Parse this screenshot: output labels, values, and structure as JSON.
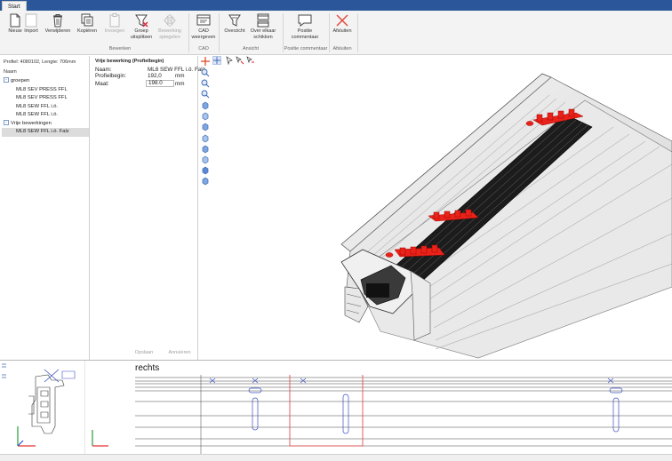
{
  "tabs": [
    {
      "label": "Start",
      "active": true
    }
  ],
  "ribbon": {
    "buttons": [
      {
        "id": "nieuw",
        "label": "Nieuw",
        "icon": "new-document-icon",
        "enabled": true
      },
      {
        "id": "import",
        "label": "Import",
        "icon": "import-icon",
        "enabled": true
      },
      {
        "id": "verwijderen",
        "label": "Verwijderen",
        "icon": "trash-icon",
        "enabled": true
      },
      {
        "id": "kopieren",
        "label": "Kopiëren",
        "icon": "copy-icon",
        "enabled": true
      },
      {
        "id": "invoegen",
        "label": "Invoegen",
        "icon": "paste-icon",
        "enabled": false
      },
      {
        "id": "groep_uitsplitsen",
        "label": "Groep uitsplitsen",
        "icon": "split-group-icon",
        "enabled": true
      },
      {
        "id": "bewerking_spiegelen",
        "label": "Bewerking spiegelen",
        "icon": "mirror-icon",
        "enabled": false
      },
      {
        "id": "cad_weergeven",
        "label": "CAD weergeven",
        "icon": "cad-icon",
        "enabled": true
      },
      {
        "id": "overzicht",
        "label": "Overzicht",
        "icon": "overview-icon",
        "enabled": true
      },
      {
        "id": "over_elkaar_schikken",
        "label": "Over elkaar schikken",
        "icon": "stack-windows-icon",
        "enabled": true
      },
      {
        "id": "positie_commentaar",
        "label": "Positie commentaar",
        "icon": "comment-icon",
        "enabled": true
      },
      {
        "id": "afsluiten",
        "label": "Afsluiten",
        "icon": "close-x-icon",
        "enabled": true
      }
    ],
    "groups": {
      "bewerken": "Bewerken",
      "cad": "CAD",
      "ansicht": "Ansicht",
      "positie_commentaar": "Positie commentaar",
      "afsluiten": "Afsluiten"
    }
  },
  "tree_panel": {
    "profile_info": "Profiel: 4080102, Lengte: 706mm",
    "column_header": "Naam",
    "nodes": [
      {
        "label": "groepen",
        "level": 0,
        "expander": "-",
        "selected": false
      },
      {
        "label": "ML8 SEV PRESS FFL",
        "level": 1,
        "selected": false
      },
      {
        "label": "ML8 SEV PRESS FFL",
        "level": 1,
        "selected": false
      },
      {
        "label": "ML8 SEW FFL i.ö.",
        "level": 1,
        "selected": false
      },
      {
        "label": "ML8 SEW FFL i.ö.",
        "level": 1,
        "selected": false
      },
      {
        "label": "Vrije bewerkingen",
        "level": 0,
        "expander": "-",
        "selected": false
      },
      {
        "label": "ML8 SEW FFL i.ö. Falz",
        "level": 1,
        "selected": true
      }
    ]
  },
  "properties": {
    "title": "Vrije bewerking (Profielbegin)",
    "naam_label": "Naam:",
    "naam_value": "ML8 SEW FFL i.ö. Falz",
    "profielbegin_label": "Profielbegin:",
    "profielbegin_value": "192,0",
    "profielbegin_unit": "mm",
    "maat_label": "Maat:",
    "maat_value": "198.0",
    "maat_unit": "mm",
    "opslaan": "Opslaan",
    "annuleren": "Annuleren"
  },
  "bottom_view": {
    "title": "rechts"
  },
  "colors": {
    "tabbar": "#2b579a",
    "highlight_red": "#e8231a",
    "outline_blue": "#3a4fc2",
    "selection_red": "#e05050"
  }
}
